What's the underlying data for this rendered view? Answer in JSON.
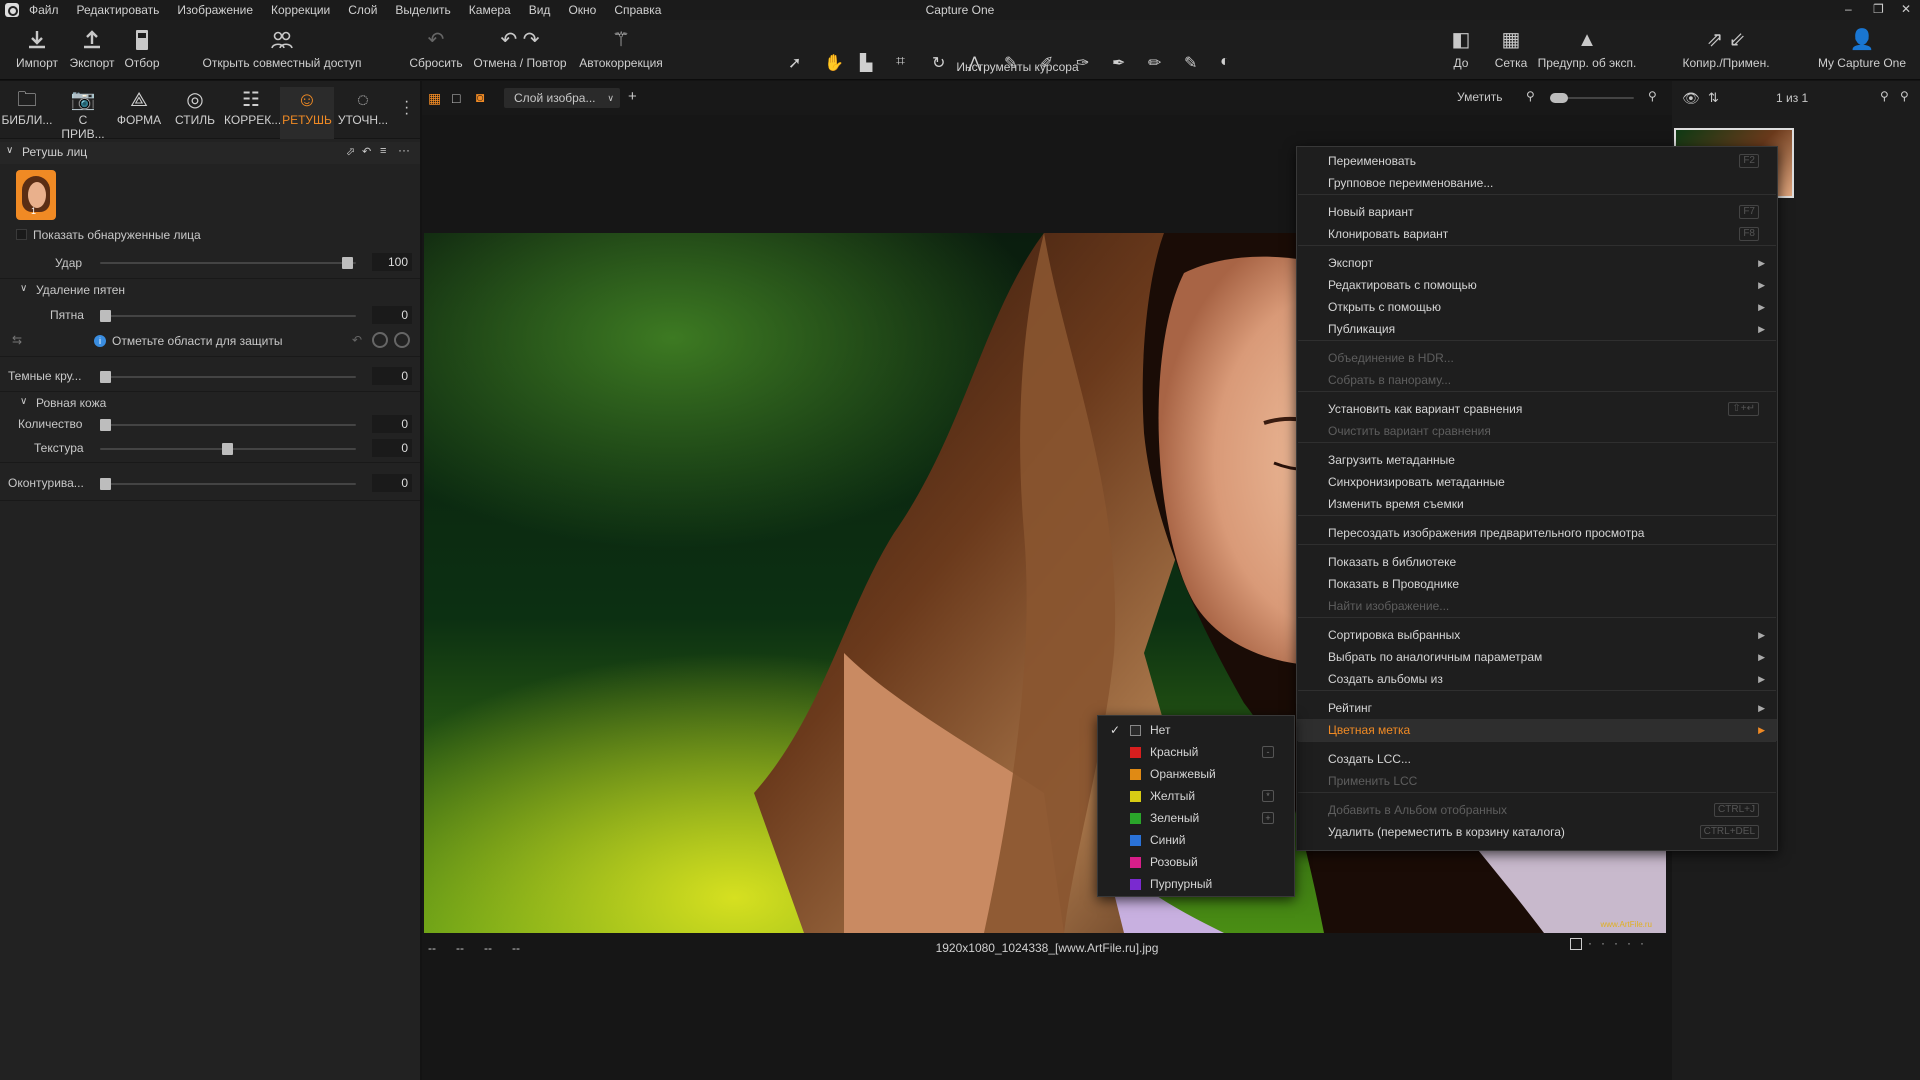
{
  "app": {
    "title": "Capture One",
    "logo_icon": "capture-one-logo-icon"
  },
  "menu": [
    "Файл",
    "Редактировать",
    "Изображение",
    "Коррекции",
    "Слой",
    "Выделить",
    "Камера",
    "Вид",
    "Окно",
    "Справка"
  ],
  "window": {
    "minimize": "–",
    "restore": "❐",
    "close": "✕"
  },
  "toolbar": {
    "import": "Импорт",
    "export": "Экспорт",
    "cull": "Отбор",
    "share": "Открыть совместный доступ",
    "reset": "Сбросить",
    "undo_redo": "Отмена / Повтор",
    "auto": "Автокоррекция",
    "cursor_tools": "Инструменты курсора",
    "before": "До",
    "grid": "Сетка",
    "exposure_warning": "Предупр. об эксп.",
    "copy_apply": "Копир./Примен.",
    "account": "My Capture One"
  },
  "tool_tabs": [
    {
      "label": "БИБЛИ...",
      "icon": "folder-icon"
    },
    {
      "label": "С ПРИВ...",
      "icon": "camera-icon"
    },
    {
      "label": "ФОРМА",
      "icon": "lens-icon"
    },
    {
      "label": "СТИЛЬ",
      "icon": "style-icon"
    },
    {
      "label": "КОРРЕК...",
      "icon": "sliders-icon"
    },
    {
      "label": "РЕТУШЬ",
      "icon": "face-retouch-icon"
    },
    {
      "label": "УТОЧН...",
      "icon": "refine-icon"
    }
  ],
  "retouch": {
    "title": "Ретушь лиц",
    "face_count": "1",
    "show_faces": "Показать обнаруженные лица",
    "strength_label": "Удар",
    "strength_value": "100",
    "blemish_title": "Удаление пятен",
    "spots_label": "Пятна",
    "spots_value": "0",
    "protect_hint": "Отметьте области для защиты",
    "dark_circles_label": "Темные кру...",
    "dark_circles_value": "0",
    "smooth_title": "Ровная кожа",
    "amount_label": "Количество",
    "amount_value": "0",
    "texture_label": "Текстура",
    "texture_value": "0",
    "contour_label": "Оконтурива...",
    "contour_value": "0"
  },
  "viewer": {
    "layer_select": "Слой изобра...",
    "add_layer": "+",
    "fit": "Уметить",
    "filename": "1920x1080_1024338_[www.ArtFile.ru].jpg",
    "meta": [
      "--",
      "--",
      "--",
      "--"
    ],
    "counter": "1 из 1",
    "watermark": "www.ArtFile.ru"
  },
  "context_menu": [
    {
      "label": "Переименовать",
      "shortcut": "F2"
    },
    {
      "label": "Групповое переименование..."
    },
    {
      "sep": true
    },
    {
      "label": "Новый вариант",
      "shortcut": "F7"
    },
    {
      "label": "Клонировать вариант",
      "shortcut": "F8"
    },
    {
      "sep": true
    },
    {
      "label": "Экспорт",
      "submenu": true
    },
    {
      "label": "Редактировать с помощью",
      "submenu": true
    },
    {
      "label": "Открыть с помощью",
      "submenu": true
    },
    {
      "label": "Публикация",
      "submenu": true
    },
    {
      "sep": true
    },
    {
      "label": "Объединение в HDR...",
      "disabled": true
    },
    {
      "label": "Собрать в панораму...",
      "disabled": true
    },
    {
      "sep": true
    },
    {
      "label": "Установить как вариант сравнения",
      "shortcut": "⇧+↵"
    },
    {
      "label": "Очистить вариант сравнения",
      "disabled": true
    },
    {
      "sep": true
    },
    {
      "label": "Загрузить метаданные"
    },
    {
      "label": "Синхронизировать метаданные"
    },
    {
      "label": "Изменить время съемки"
    },
    {
      "sep": true
    },
    {
      "label": "Пересоздать изображения предварительного просмотра"
    },
    {
      "sep": true
    },
    {
      "label": "Показать в библиотеке"
    },
    {
      "label": "Показать в Проводнике"
    },
    {
      "label": "Найти изображение...",
      "disabled": true
    },
    {
      "sep": true
    },
    {
      "label": "Сортировка выбранных",
      "submenu": true
    },
    {
      "label": "Выбрать по аналогичным параметрам",
      "submenu": true
    },
    {
      "label": "Создать альбомы из",
      "submenu": true
    },
    {
      "sep": true
    },
    {
      "label": "Рейтинг",
      "submenu": true
    },
    {
      "label": "Цветная метка",
      "submenu": true,
      "highlight": true
    },
    {
      "sep": true
    },
    {
      "label": "Создать LCC..."
    },
    {
      "label": "Применить LCC",
      "disabled": true
    },
    {
      "sep": true
    },
    {
      "label": "Добавить в Альбом отобранных",
      "shortcut": "CTRL+J",
      "disabled": true
    },
    {
      "label": "Удалить (переместить в корзину каталога)",
      "shortcut": "CTRL+DEL"
    }
  ],
  "color_submenu": [
    {
      "label": "Нет",
      "color": "#2a2a2a",
      "checked": true
    },
    {
      "label": "Красный",
      "color": "#d81e1e",
      "key": "-"
    },
    {
      "label": "Оранжевый",
      "color": "#e08a14"
    },
    {
      "label": "Желтый",
      "color": "#d8cc14",
      "key": "*"
    },
    {
      "label": "Зеленый",
      "color": "#2aa52a",
      "key": "+"
    },
    {
      "label": "Синий",
      "color": "#2a72d8"
    },
    {
      "label": "Розовый",
      "color": "#d81e8a"
    },
    {
      "label": "Пурпурный",
      "color": "#7a2ad0"
    }
  ]
}
